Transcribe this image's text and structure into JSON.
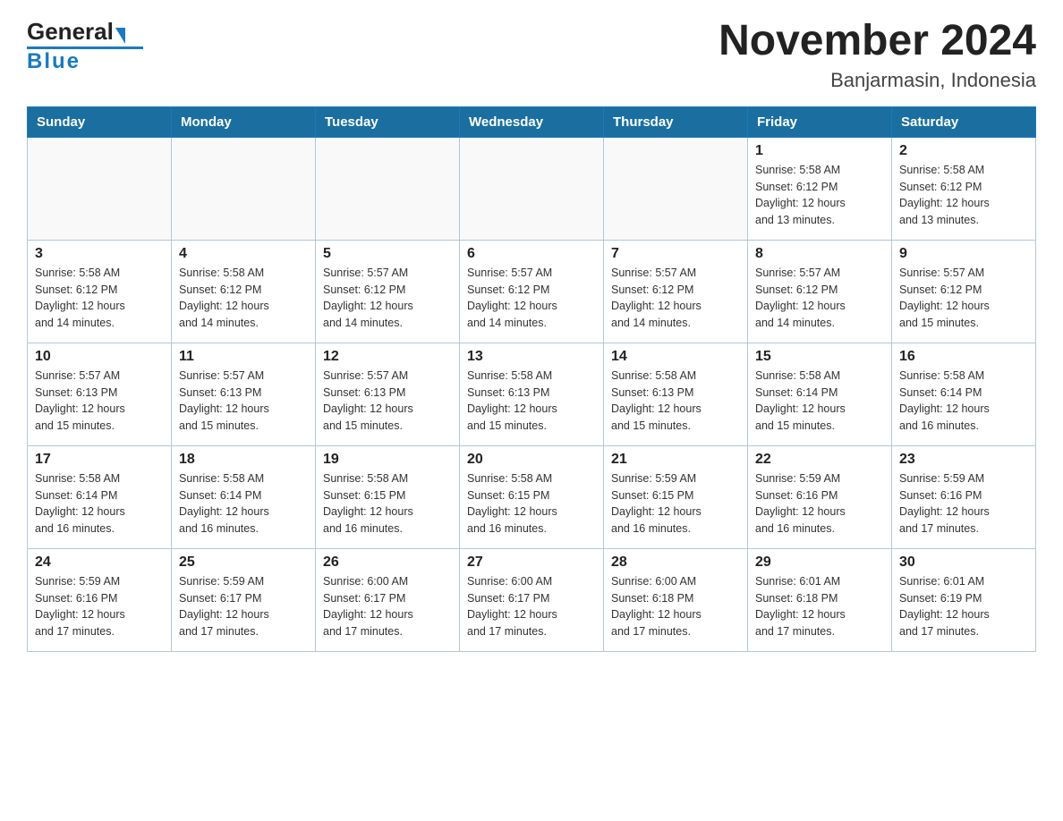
{
  "header": {
    "logo_general": "General",
    "logo_blue": "Blue",
    "main_title": "November 2024",
    "subtitle": "Banjarmasin, Indonesia"
  },
  "calendar": {
    "days_of_week": [
      "Sunday",
      "Monday",
      "Tuesday",
      "Wednesday",
      "Thursday",
      "Friday",
      "Saturday"
    ],
    "weeks": [
      [
        {
          "day": "",
          "info": ""
        },
        {
          "day": "",
          "info": ""
        },
        {
          "day": "",
          "info": ""
        },
        {
          "day": "",
          "info": ""
        },
        {
          "day": "",
          "info": ""
        },
        {
          "day": "1",
          "info": "Sunrise: 5:58 AM\nSunset: 6:12 PM\nDaylight: 12 hours\nand 13 minutes."
        },
        {
          "day": "2",
          "info": "Sunrise: 5:58 AM\nSunset: 6:12 PM\nDaylight: 12 hours\nand 13 minutes."
        }
      ],
      [
        {
          "day": "3",
          "info": "Sunrise: 5:58 AM\nSunset: 6:12 PM\nDaylight: 12 hours\nand 14 minutes."
        },
        {
          "day": "4",
          "info": "Sunrise: 5:58 AM\nSunset: 6:12 PM\nDaylight: 12 hours\nand 14 minutes."
        },
        {
          "day": "5",
          "info": "Sunrise: 5:57 AM\nSunset: 6:12 PM\nDaylight: 12 hours\nand 14 minutes."
        },
        {
          "day": "6",
          "info": "Sunrise: 5:57 AM\nSunset: 6:12 PM\nDaylight: 12 hours\nand 14 minutes."
        },
        {
          "day": "7",
          "info": "Sunrise: 5:57 AM\nSunset: 6:12 PM\nDaylight: 12 hours\nand 14 minutes."
        },
        {
          "day": "8",
          "info": "Sunrise: 5:57 AM\nSunset: 6:12 PM\nDaylight: 12 hours\nand 14 minutes."
        },
        {
          "day": "9",
          "info": "Sunrise: 5:57 AM\nSunset: 6:12 PM\nDaylight: 12 hours\nand 15 minutes."
        }
      ],
      [
        {
          "day": "10",
          "info": "Sunrise: 5:57 AM\nSunset: 6:13 PM\nDaylight: 12 hours\nand 15 minutes."
        },
        {
          "day": "11",
          "info": "Sunrise: 5:57 AM\nSunset: 6:13 PM\nDaylight: 12 hours\nand 15 minutes."
        },
        {
          "day": "12",
          "info": "Sunrise: 5:57 AM\nSunset: 6:13 PM\nDaylight: 12 hours\nand 15 minutes."
        },
        {
          "day": "13",
          "info": "Sunrise: 5:58 AM\nSunset: 6:13 PM\nDaylight: 12 hours\nand 15 minutes."
        },
        {
          "day": "14",
          "info": "Sunrise: 5:58 AM\nSunset: 6:13 PM\nDaylight: 12 hours\nand 15 minutes."
        },
        {
          "day": "15",
          "info": "Sunrise: 5:58 AM\nSunset: 6:14 PM\nDaylight: 12 hours\nand 15 minutes."
        },
        {
          "day": "16",
          "info": "Sunrise: 5:58 AM\nSunset: 6:14 PM\nDaylight: 12 hours\nand 16 minutes."
        }
      ],
      [
        {
          "day": "17",
          "info": "Sunrise: 5:58 AM\nSunset: 6:14 PM\nDaylight: 12 hours\nand 16 minutes."
        },
        {
          "day": "18",
          "info": "Sunrise: 5:58 AM\nSunset: 6:14 PM\nDaylight: 12 hours\nand 16 minutes."
        },
        {
          "day": "19",
          "info": "Sunrise: 5:58 AM\nSunset: 6:15 PM\nDaylight: 12 hours\nand 16 minutes."
        },
        {
          "day": "20",
          "info": "Sunrise: 5:58 AM\nSunset: 6:15 PM\nDaylight: 12 hours\nand 16 minutes."
        },
        {
          "day": "21",
          "info": "Sunrise: 5:59 AM\nSunset: 6:15 PM\nDaylight: 12 hours\nand 16 minutes."
        },
        {
          "day": "22",
          "info": "Sunrise: 5:59 AM\nSunset: 6:16 PM\nDaylight: 12 hours\nand 16 minutes."
        },
        {
          "day": "23",
          "info": "Sunrise: 5:59 AM\nSunset: 6:16 PM\nDaylight: 12 hours\nand 17 minutes."
        }
      ],
      [
        {
          "day": "24",
          "info": "Sunrise: 5:59 AM\nSunset: 6:16 PM\nDaylight: 12 hours\nand 17 minutes."
        },
        {
          "day": "25",
          "info": "Sunrise: 5:59 AM\nSunset: 6:17 PM\nDaylight: 12 hours\nand 17 minutes."
        },
        {
          "day": "26",
          "info": "Sunrise: 6:00 AM\nSunset: 6:17 PM\nDaylight: 12 hours\nand 17 minutes."
        },
        {
          "day": "27",
          "info": "Sunrise: 6:00 AM\nSunset: 6:17 PM\nDaylight: 12 hours\nand 17 minutes."
        },
        {
          "day": "28",
          "info": "Sunrise: 6:00 AM\nSunset: 6:18 PM\nDaylight: 12 hours\nand 17 minutes."
        },
        {
          "day": "29",
          "info": "Sunrise: 6:01 AM\nSunset: 6:18 PM\nDaylight: 12 hours\nand 17 minutes."
        },
        {
          "day": "30",
          "info": "Sunrise: 6:01 AM\nSunset: 6:19 PM\nDaylight: 12 hours\nand 17 minutes."
        }
      ]
    ]
  }
}
